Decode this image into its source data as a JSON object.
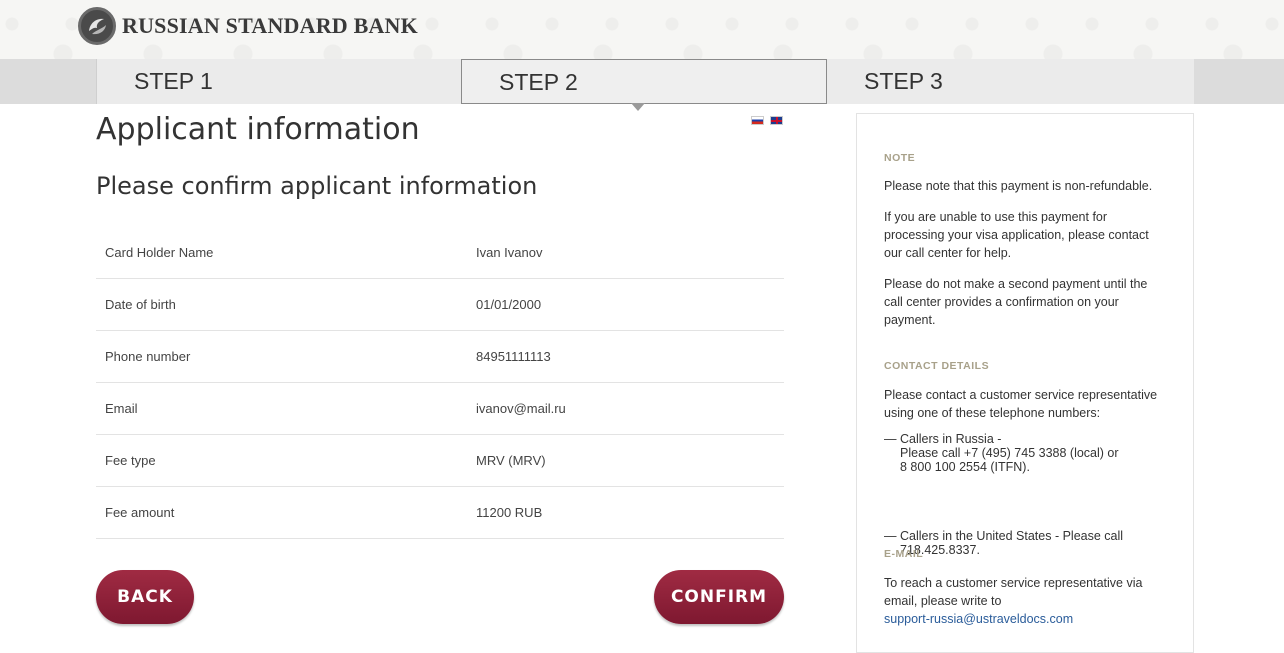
{
  "brand": {
    "name": "RUSSIAN STANDARD BANK"
  },
  "steps": [
    {
      "label": "STEP 1"
    },
    {
      "label": "STEP 2"
    },
    {
      "label": "STEP 3"
    }
  ],
  "main": {
    "title": "Applicant information",
    "subtitle": "Please confirm applicant information",
    "rows": [
      {
        "label": "Card Holder Name",
        "value": "Ivan Ivanov"
      },
      {
        "label": "Date of birth",
        "value": "01/01/2000"
      },
      {
        "label": "Phone number",
        "value": "84951111113"
      },
      {
        "label": "Email",
        "value": "ivanov@mail.ru"
      },
      {
        "label": "Fee type",
        "value": "MRV (MRV)"
      },
      {
        "label": "Fee amount",
        "value": "11200 RUB"
      }
    ],
    "back_label": "BACK",
    "confirm_label": "CONFIRM"
  },
  "sidebar": {
    "note_heading": "NOTE",
    "note_p1": "Please note that this payment is non-refundable.",
    "note_p2": "If you are unable to use this payment for processing your visa application, please contact our call center for help.",
    "note_p3": "Please do not make a second payment until the call center provides a confirmation on your payment.",
    "contact_heading": "CONTACT DETAILS",
    "contact_intro": "Please contact a customer service representative using one of these telephone numbers:",
    "callers_russia_1": "Callers in Russia -",
    "callers_russia_2": "Please call +7 (495) 745 3388 (local) or",
    "callers_russia_3": "8 800 100 2554 (ITFN).",
    "callers_us_1": "Callers in the United States - Please call",
    "callers_us_2": "718.425.8337.",
    "dash": "—",
    "email_heading": "E-MAIL",
    "email_intro": "To reach a customer service representative via email, please write to",
    "email_address": "support-russia@ustraveldocs.com"
  },
  "colors": {
    "button": "#8e2039",
    "sidebar_heading": "#a8a18a",
    "link": "#2a5c9a"
  }
}
